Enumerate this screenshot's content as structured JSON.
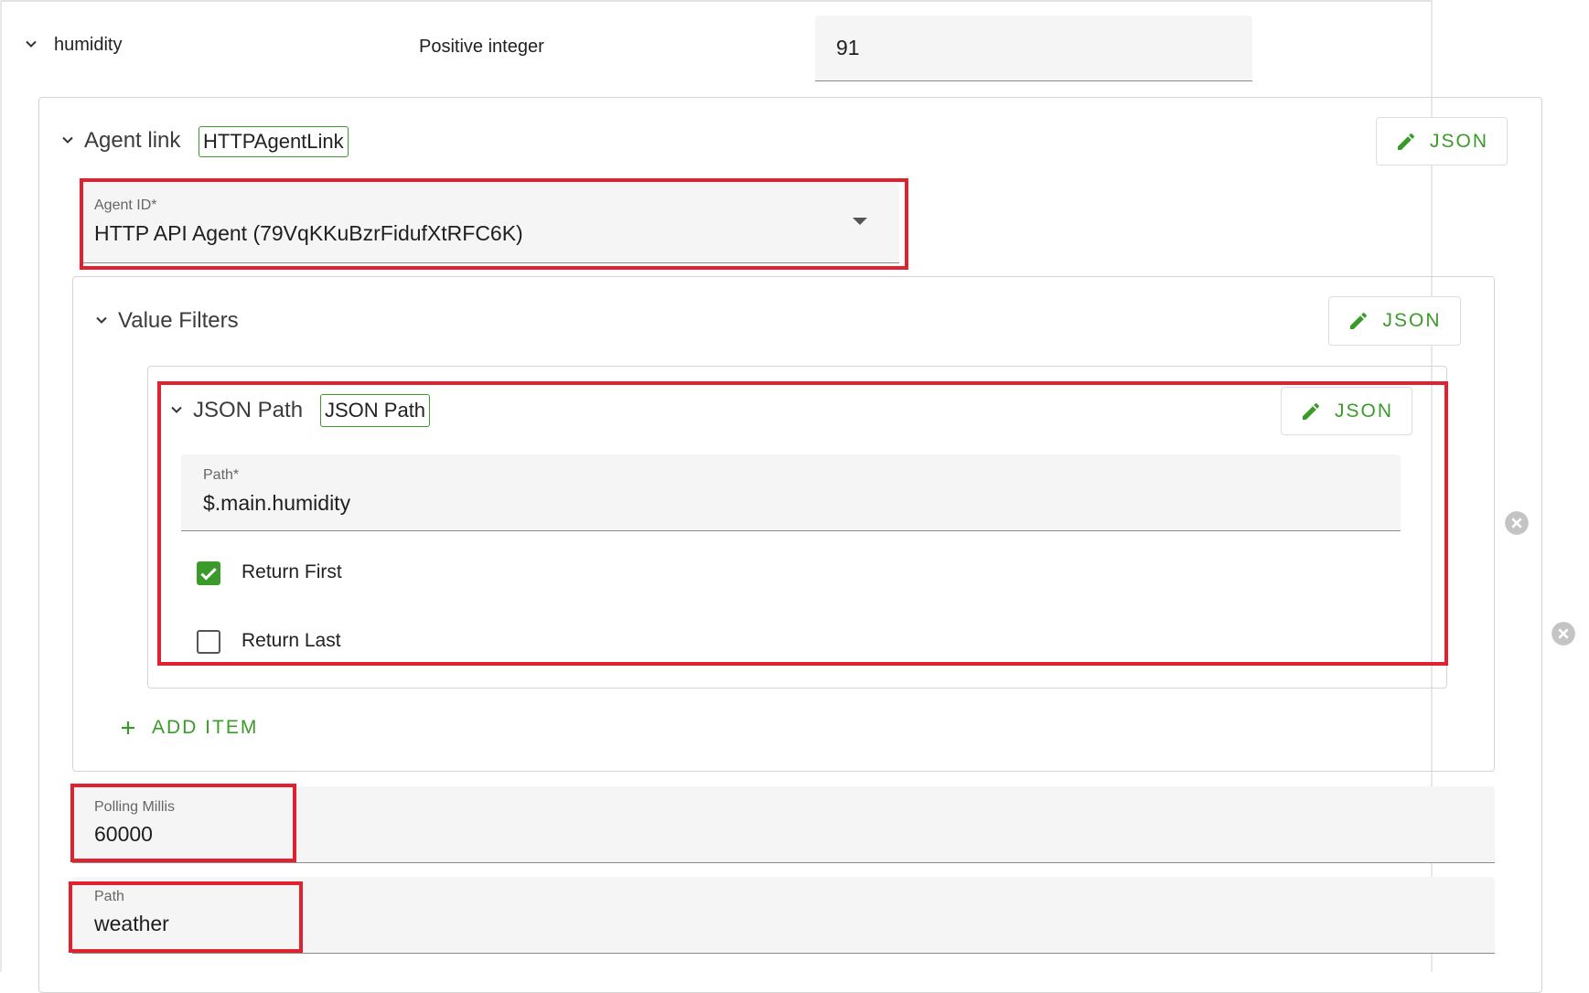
{
  "humidity_row": {
    "name": "humidity",
    "type_label": "Positive integer",
    "value": "91"
  },
  "agent_link": {
    "title": "Agent link",
    "badge": "HTTPAgentLink",
    "json_button": "JSON",
    "agent_id": {
      "label": "Agent ID*",
      "value": "HTTP API Agent (79VqKKuBzrFidufXtRFC6K)"
    }
  },
  "value_filters": {
    "title": "Value Filters",
    "json_button": "JSON",
    "filter": {
      "title": "JSON Path",
      "badge": "JSON Path",
      "json_button": "JSON",
      "path": {
        "label": "Path*",
        "value": "$.main.humidity"
      },
      "return_first": {
        "label": "Return First",
        "checked": true
      },
      "return_last": {
        "label": "Return Last",
        "checked": false
      }
    },
    "add_item": "ADD ITEM"
  },
  "polling_millis": {
    "label": "Polling Millis",
    "value": "60000"
  },
  "path_field": {
    "label": "Path",
    "value": "weather"
  },
  "colors": {
    "accent": "#3b9b2a",
    "highlight": "#e0222e",
    "field_bg": "#f5f5f5"
  }
}
